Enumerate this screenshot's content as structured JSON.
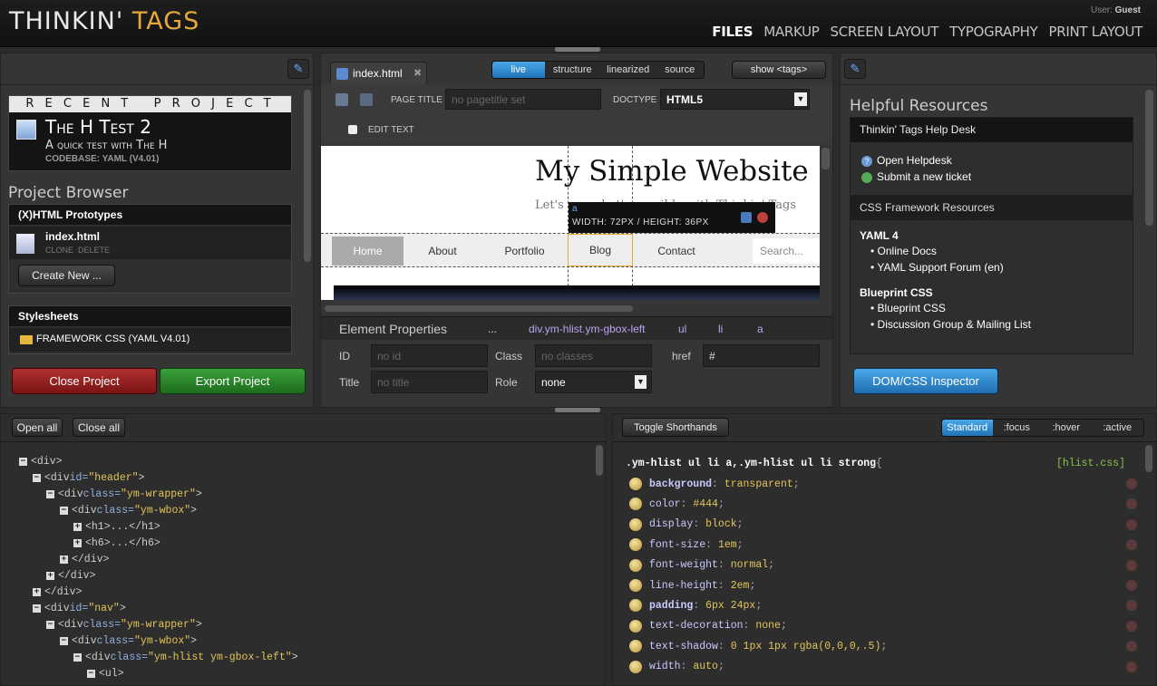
{
  "app": {
    "logo_a": "THINKIN'",
    "logo_b": " TAGS",
    "user_label": "User:",
    "user_name": "Guest"
  },
  "mainnav": [
    "Files",
    "Markup",
    "Screen Layout",
    "Typography",
    "Print Layout"
  ],
  "recent": {
    "heading": "R E C E N T   P R O J E C T",
    "title": "The H Test 2",
    "subtitle": "A quick test with The H",
    "codebase": "CODEBASE: YAML (V4.01)"
  },
  "browser": {
    "title": "Project Browser",
    "section1": "(X)HTML Prototypes",
    "file": "index.html",
    "file_actions": "CLONE  DELETE",
    "create": "Create New ...",
    "section2": "Stylesheets",
    "stylesheet": "FRAMEWORK CSS (YAML V4.01)"
  },
  "left_buttons": {
    "close": "Close Project",
    "export": "Export Project"
  },
  "editor": {
    "tab": "index.html",
    "modes": [
      "live",
      "structure",
      "linearized",
      "source"
    ],
    "show_tags": "show <tags>",
    "page_title_label": "PAGE TITLE",
    "page_title_placeholder": "no pagetitle set",
    "doctype_label": "DOCTYPE",
    "doctype_value": "HTML5",
    "edit_text": "EDIT TEXT"
  },
  "preview": {
    "site_title": "My Simple Website",
    "tagline": "Let's see what's possible with Thinkin' Tags",
    "tooltip_tag": "a",
    "tooltip_dims": "WIDTH: 72PX / HEIGHT: 36PX",
    "nav": [
      "Home",
      "About",
      "Portfolio",
      "Blog",
      "Contact"
    ],
    "search_placeholder": "Search..."
  },
  "element_props": {
    "title": "Element Properties",
    "crumbs": [
      "...",
      "div.ym-hlist.ym-gbox-left",
      "ul",
      "li",
      "a"
    ],
    "id_label": "ID",
    "id_placeholder": "no id",
    "class_label": "Class",
    "class_placeholder": "no classes",
    "href_label": "href",
    "href_value": "#",
    "title_label": "Title",
    "title_placeholder": "no title",
    "role_label": "Role",
    "role_value": "none"
  },
  "resources": {
    "title": "Helpful Resources",
    "help_header": "Thinkin' Tags Help Desk",
    "open_helpdesk": "Open Helpdesk",
    "submit_ticket": "Submit a new ticket",
    "css_header": "CSS Framework Resources",
    "yaml_title": "YAML 4",
    "yaml_links": [
      "Online Docs",
      "YAML Support Forum (en)"
    ],
    "bp_title": "Blueprint CSS",
    "bp_links": [
      "Blueprint CSS",
      "Discussion Group & Mailing List"
    ],
    "inspector": "DOM/CSS Inspector"
  },
  "tree": {
    "open_all": "Open all",
    "close_all": "Close all"
  },
  "css_panel": {
    "toggle": "Toggle Shorthands",
    "states": [
      "Standard",
      ":focus",
      ":hover",
      ":active"
    ],
    "selector": ".ym-hlist ul li a,.ym-hlist ul li strong",
    "open_brace": "{",
    "source": "[hlist.css]",
    "rules": [
      {
        "p": "background",
        "v": "transparent",
        "bold": true
      },
      {
        "p": "color",
        "v": "#444",
        "bold": false
      },
      {
        "p": "display",
        "v": "block",
        "bold": false
      },
      {
        "p": "font-size",
        "v": "1em",
        "bold": false
      },
      {
        "p": "font-weight",
        "v": "normal",
        "bold": false
      },
      {
        "p": "line-height",
        "v": "2em",
        "bold": false
      },
      {
        "p": "padding",
        "v": "6px 24px",
        "bold": true
      },
      {
        "p": "text-decoration",
        "v": "none",
        "bold": false
      },
      {
        "p": "text-shadow",
        "v": "0 1px 1px rgba(0,0,0,.5)",
        "bold": false
      },
      {
        "p": "width",
        "v": "auto",
        "bold": false
      }
    ]
  }
}
